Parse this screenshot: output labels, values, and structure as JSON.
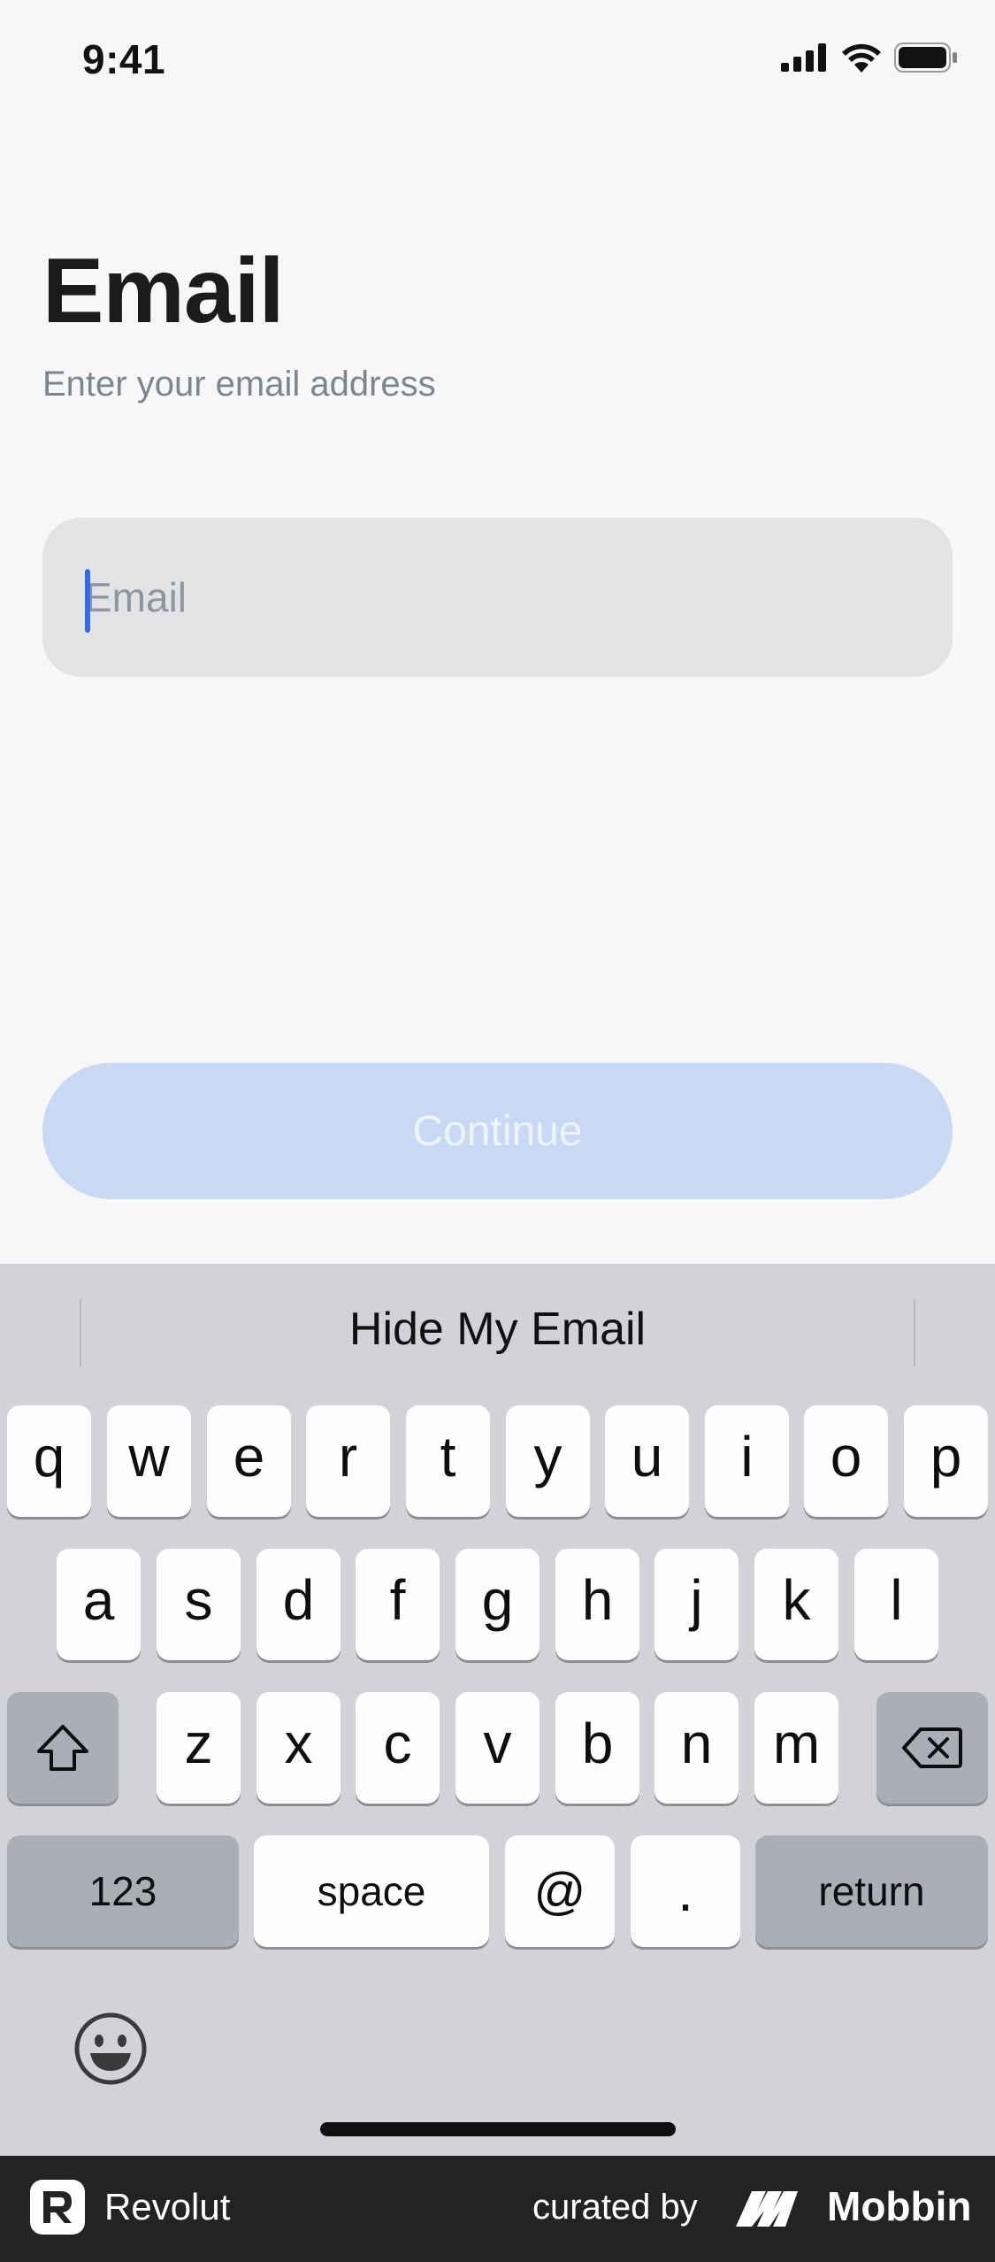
{
  "status_bar": {
    "time": "9:41",
    "icons": [
      "signal-icon",
      "wifi-icon",
      "battery-icon"
    ]
  },
  "header": {
    "title": "Email",
    "subtitle": "Enter your email address"
  },
  "email_field": {
    "value": "",
    "placeholder": "Email"
  },
  "continue_button": {
    "label": "Continue",
    "enabled": false
  },
  "keyboard": {
    "suggestion": "Hide My Email",
    "row1": [
      "q",
      "w",
      "e",
      "r",
      "t",
      "y",
      "u",
      "i",
      "o",
      "p"
    ],
    "row2": [
      "a",
      "s",
      "d",
      "f",
      "g",
      "h",
      "j",
      "k",
      "l"
    ],
    "row3": [
      "z",
      "x",
      "c",
      "v",
      "b",
      "n",
      "m"
    ],
    "shift_icon": "shift-icon",
    "delete_icon": "delete-icon",
    "numbers_label": "123",
    "space_label": "space",
    "at_label": "@",
    "dot_label": ".",
    "return_label": "return",
    "emoji_icon": "emoji-icon"
  },
  "footer": {
    "brand": "Revolut",
    "curated_by": "curated by",
    "curator": "Mobbin"
  },
  "colors": {
    "background": "#f7f7f7",
    "caret": "#2f6bea",
    "continue_disabled": "#c7d9f5",
    "keyboard_bg": "#d2d3d8",
    "footer_bg": "#232325"
  }
}
